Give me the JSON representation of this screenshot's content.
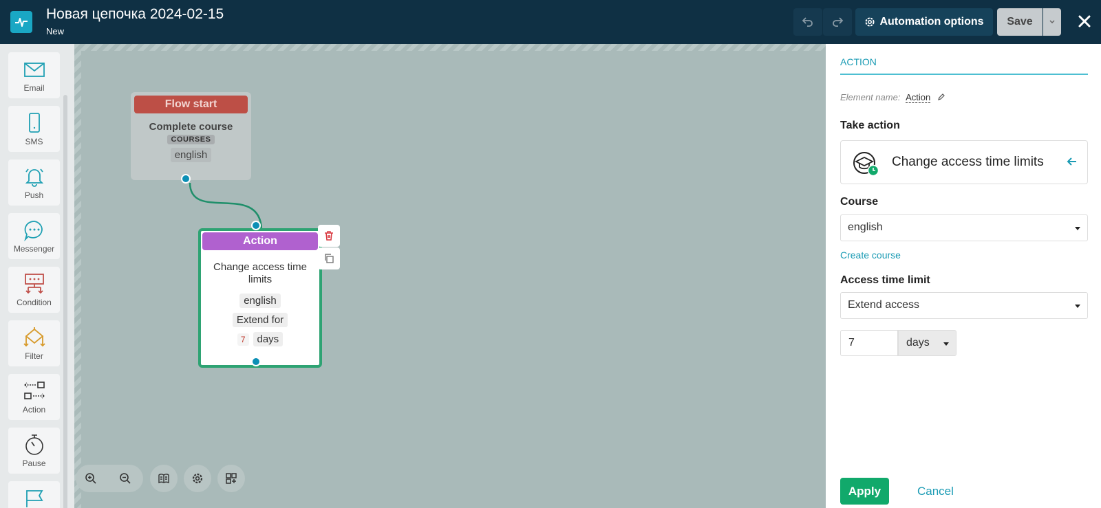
{
  "header": {
    "title": "Новая цепочка 2024-02-15",
    "status": "New",
    "automation_options_label": "Automation options",
    "save_label": "Save"
  },
  "toolbar": {
    "items": [
      {
        "label": "Email",
        "icon": "envelope-icon"
      },
      {
        "label": "SMS",
        "icon": "phone-icon"
      },
      {
        "label": "Push",
        "icon": "bell-icon"
      },
      {
        "label": "Messenger",
        "icon": "chat-icon"
      },
      {
        "label": "Condition",
        "icon": "condition-icon"
      },
      {
        "label": "Filter",
        "icon": "filter-icon"
      },
      {
        "label": "Action",
        "icon": "action-icon"
      },
      {
        "label": "Pause",
        "icon": "stopwatch-icon"
      }
    ]
  },
  "canvas": {
    "start_node": {
      "header": "Flow start",
      "title": "Complete course",
      "tag": "COURSES",
      "course": "english"
    },
    "action_node": {
      "header": "Action",
      "title": "Change access time limits",
      "course": "english",
      "mode": "Extend for",
      "amount": "7",
      "unit": "days"
    }
  },
  "panel": {
    "tab": "ACTION",
    "element_name_label": "Element name:",
    "element_name_value": "Action",
    "take_action_label": "Take action",
    "take_action_value": "Change access time limits",
    "course_label": "Course",
    "course_value": "english",
    "create_course_link": "Create course",
    "access_limit_label": "Access time limit",
    "access_limit_value": "Extend access",
    "amount_value": "7",
    "unit_value": "days",
    "apply_label": "Apply",
    "cancel_label": "Cancel"
  },
  "colors": {
    "header_bg": "#0f3044",
    "accent": "#1a9bb4",
    "start_red": "#bd4f46",
    "action_purple": "#b061cf",
    "apply_green": "#11a96b"
  }
}
